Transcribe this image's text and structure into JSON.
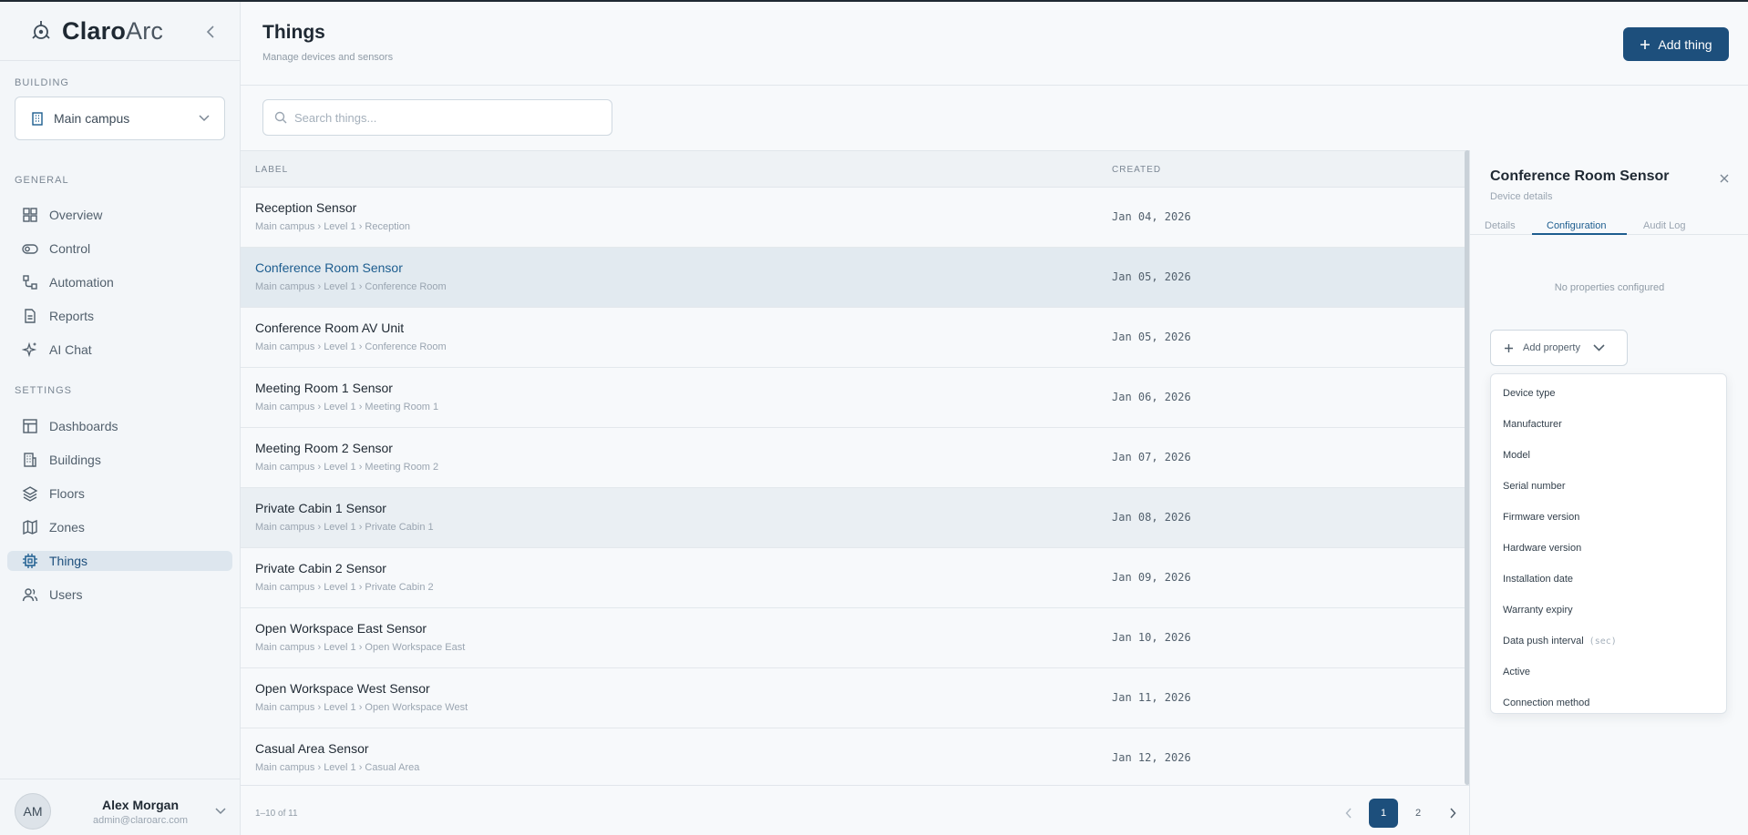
{
  "brand": {
    "name_bold": "Claro",
    "name_light": "Arc"
  },
  "sidebar": {
    "building_label": "BUILDING",
    "building_value": "Main campus",
    "general_label": "GENERAL",
    "settings_label": "SETTINGS",
    "general_items": [
      {
        "label": "Overview",
        "icon": "grid-icon"
      },
      {
        "label": "Control",
        "icon": "toggle-icon"
      },
      {
        "label": "Automation",
        "icon": "workflow-icon"
      },
      {
        "label": "Reports",
        "icon": "document-icon"
      },
      {
        "label": "AI Chat",
        "icon": "sparkle-icon"
      }
    ],
    "settings_items": [
      {
        "label": "Dashboards",
        "icon": "layout-icon"
      },
      {
        "label": "Buildings",
        "icon": "building-icon"
      },
      {
        "label": "Floors",
        "icon": "layers-icon"
      },
      {
        "label": "Zones",
        "icon": "map-icon"
      },
      {
        "label": "Things",
        "icon": "chip-icon",
        "active": true
      },
      {
        "label": "Users",
        "icon": "users-icon"
      }
    ],
    "user": {
      "initials": "AM",
      "name": "Alex Morgan",
      "email": "admin@claroarc.com"
    }
  },
  "header": {
    "title": "Things",
    "subtitle": "Manage devices and sensors",
    "add_button": "Add thing"
  },
  "search": {
    "placeholder": "Search things..."
  },
  "table": {
    "columns": {
      "label": "LABEL",
      "created": "CREATED"
    },
    "rows": [
      {
        "title": "Reception Sensor",
        "path": "Main campus › Level 1 › Reception",
        "created": "Jan 04, 2026"
      },
      {
        "title": "Conference Room Sensor",
        "path": "Main campus › Level 1 › Conference Room",
        "created": "Jan 05, 2026",
        "selected": true
      },
      {
        "title": "Conference Room AV Unit",
        "path": "Main campus › Level 1 › Conference Room",
        "created": "Jan 05, 2026"
      },
      {
        "title": "Meeting Room 1 Sensor",
        "path": "Main campus › Level 1 › Meeting Room 1",
        "created": "Jan 06, 2026"
      },
      {
        "title": "Meeting Room 2 Sensor",
        "path": "Main campus › Level 1 › Meeting Room 2",
        "created": "Jan 07, 2026"
      },
      {
        "title": "Private Cabin 1 Sensor",
        "path": "Main campus › Level 1 › Private Cabin 1",
        "created": "Jan 08, 2026",
        "hover": true
      },
      {
        "title": "Private Cabin 2 Sensor",
        "path": "Main campus › Level 1 › Private Cabin 2",
        "created": "Jan 09, 2026"
      },
      {
        "title": "Open Workspace East Sensor",
        "path": "Main campus › Level 1 › Open Workspace East",
        "created": "Jan 10, 2026"
      },
      {
        "title": "Open Workspace West Sensor",
        "path": "Main campus › Level 1 › Open Workspace West",
        "created": "Jan 11, 2026"
      },
      {
        "title": "Casual Area Sensor",
        "path": "Main campus › Level 1 › Casual Area",
        "created": "Jan 12, 2026"
      }
    ],
    "range_text": "1–10 of 11",
    "pages": [
      "1",
      "2"
    ],
    "current_page": "1"
  },
  "panel": {
    "title": "Conference Room Sensor",
    "subtitle": "Device details",
    "tabs": [
      "Details",
      "Configuration",
      "Audit Log"
    ],
    "active_tab": "Configuration",
    "empty_text": "No properties configured",
    "add_property": "Add property",
    "property_options": [
      {
        "label": "Device type"
      },
      {
        "label": "Manufacturer"
      },
      {
        "label": "Model"
      },
      {
        "label": "Serial number"
      },
      {
        "label": "Firmware version"
      },
      {
        "label": "Hardware version"
      },
      {
        "label": "Installation date"
      },
      {
        "label": "Warranty expiry"
      },
      {
        "label": "Data push interval",
        "hint": "(sec)"
      },
      {
        "label": "Active"
      },
      {
        "label": "Connection method"
      }
    ]
  },
  "colors": {
    "accent": "#1d4f7c",
    "selected_row": "#e2eaf0",
    "sidebar_bg": "#f3f6f9"
  }
}
